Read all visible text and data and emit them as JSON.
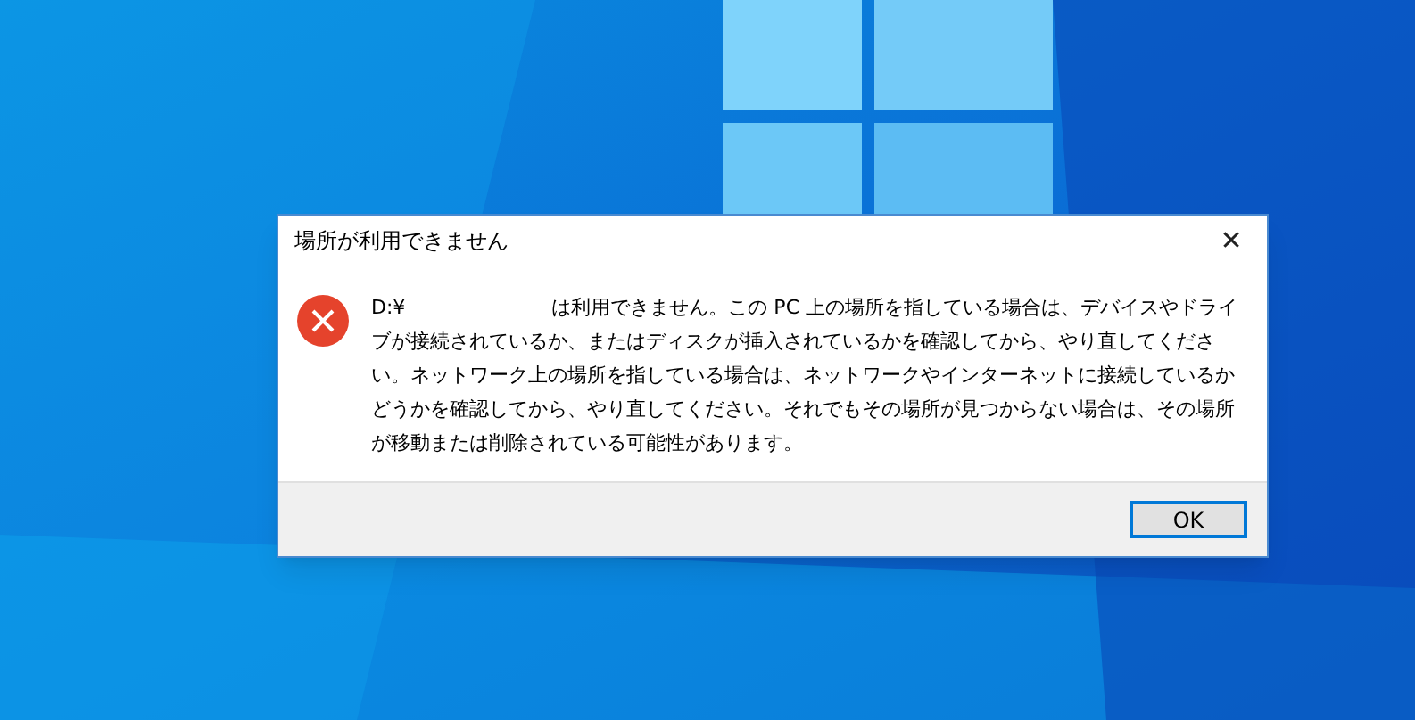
{
  "dialog": {
    "title": "場所が利用できません",
    "close": "✕",
    "path": "D:¥",
    "message": "は利用できません。この PC 上の場所を指している場合は、デバイスやドライブが接続されているか、またはディスクが挿入されているかを確認してから、やり直してください。ネットワーク上の場所を指している場合は、ネットワークやインターネットに接続しているかどうかを確認してから、やり直してください。それでもその場所が見つからない場合は、その場所が移動または削除されている可能性があります。",
    "buttons": [
      {
        "label": "OK",
        "selected": true
      }
    ]
  }
}
